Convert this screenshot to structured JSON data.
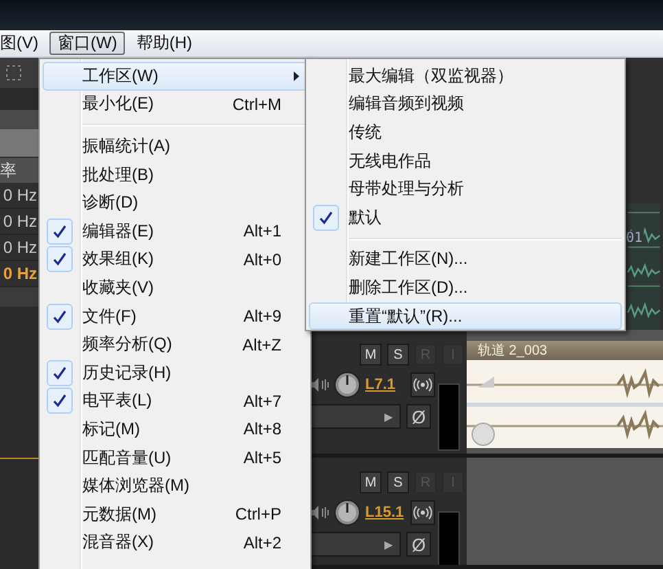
{
  "menubar": [
    {
      "label": "图(V)",
      "selected": false
    },
    {
      "label": "窗口(W)",
      "selected": true
    },
    {
      "label": "帮助(H)",
      "selected": false
    }
  ],
  "left_panel": {
    "header": "率",
    "rows": [
      {
        "text": "0 Hz",
        "selected": false
      },
      {
        "text": "0 Hz",
        "selected": false
      },
      {
        "text": "0 Hz",
        "selected": false
      },
      {
        "text": "0 Hz",
        "selected": true
      }
    ]
  },
  "ruler_label": "01",
  "window_menu": {
    "items": [
      {
        "kind": "item",
        "label": "工作区(W)",
        "submenu": true,
        "checked": false,
        "selected": true
      },
      {
        "kind": "item",
        "label": "最小化(E)",
        "shortcut": "Ctrl+M",
        "submenu": false,
        "checked": false,
        "selected": false
      },
      {
        "kind": "separator"
      },
      {
        "kind": "item",
        "label": "振幅统计(A)",
        "submenu": false,
        "checked": false,
        "selected": false
      },
      {
        "kind": "item",
        "label": "批处理(B)",
        "submenu": false,
        "checked": false,
        "selected": false
      },
      {
        "kind": "item",
        "label": "诊断(D)",
        "submenu": false,
        "checked": false,
        "selected": false
      },
      {
        "kind": "item",
        "label": "编辑器(E)",
        "shortcut": "Alt+1",
        "submenu": false,
        "checked": true,
        "selected": false
      },
      {
        "kind": "item",
        "label": "效果组(K)",
        "shortcut": "Alt+0",
        "submenu": false,
        "checked": true,
        "selected": false
      },
      {
        "kind": "item",
        "label": "收藏夹(V)",
        "submenu": false,
        "checked": false,
        "selected": false
      },
      {
        "kind": "item",
        "label": "文件(F)",
        "shortcut": "Alt+9",
        "submenu": false,
        "checked": true,
        "selected": false
      },
      {
        "kind": "item",
        "label": "频率分析(Q)",
        "shortcut": "Alt+Z",
        "submenu": false,
        "checked": false,
        "selected": false
      },
      {
        "kind": "item",
        "label": "历史记录(H)",
        "submenu": false,
        "checked": true,
        "selected": false
      },
      {
        "kind": "item",
        "label": "电平表(L)",
        "shortcut": "Alt+7",
        "submenu": false,
        "checked": true,
        "selected": false
      },
      {
        "kind": "item",
        "label": "标记(M)",
        "shortcut": "Alt+8",
        "submenu": false,
        "checked": false,
        "selected": false
      },
      {
        "kind": "item",
        "label": "匹配音量(U)",
        "shortcut": "Alt+5",
        "submenu": false,
        "checked": false,
        "selected": false
      },
      {
        "kind": "item",
        "label": "媒体浏览器(M)",
        "submenu": false,
        "checked": false,
        "selected": false
      },
      {
        "kind": "item",
        "label": "元数据(M)",
        "shortcut": "Ctrl+P",
        "submenu": false,
        "checked": false,
        "selected": false
      },
      {
        "kind": "item",
        "label": "混音器(X)",
        "shortcut": "Alt+2",
        "submenu": false,
        "checked": false,
        "selected": false
      }
    ]
  },
  "workspace_submenu": {
    "items": [
      {
        "kind": "item",
        "label": "最大编辑（双监视器）",
        "checked": false,
        "selected": false
      },
      {
        "kind": "item",
        "label": "编辑音频到视频",
        "checked": false,
        "selected": false
      },
      {
        "kind": "item",
        "label": "传统",
        "checked": false,
        "selected": false
      },
      {
        "kind": "item",
        "label": "无线电作品",
        "checked": false,
        "selected": false
      },
      {
        "kind": "item",
        "label": "母带处理与分析",
        "checked": false,
        "selected": false
      },
      {
        "kind": "item",
        "label": "默认",
        "checked": true,
        "selected": false
      },
      {
        "kind": "separator"
      },
      {
        "kind": "item",
        "label": "新建工作区(N)...",
        "checked": false,
        "selected": false
      },
      {
        "kind": "item",
        "label": "删除工作区(D)...",
        "checked": false,
        "selected": false
      },
      {
        "kind": "item",
        "label": "重置“默认”(R)...",
        "checked": false,
        "selected": true
      }
    ]
  },
  "tracks": [
    {
      "buttons": [
        {
          "label": "M",
          "disabled": false
        },
        {
          "label": "S",
          "disabled": false
        },
        {
          "label": "R",
          "disabled": true
        },
        {
          "label": "I",
          "disabled": true
        }
      ],
      "channel": "L7.1",
      "output_arrow": "▶",
      "phase": "Ø",
      "clip_label": "轨道 2_003"
    },
    {
      "buttons": [
        {
          "label": "M",
          "disabled": false
        },
        {
          "label": "S",
          "disabled": false
        },
        {
          "label": "R",
          "disabled": true
        },
        {
          "label": "I",
          "disabled": true
        }
      ],
      "channel": "L15.1",
      "output_arrow": "▶",
      "phase": "Ø"
    }
  ]
}
